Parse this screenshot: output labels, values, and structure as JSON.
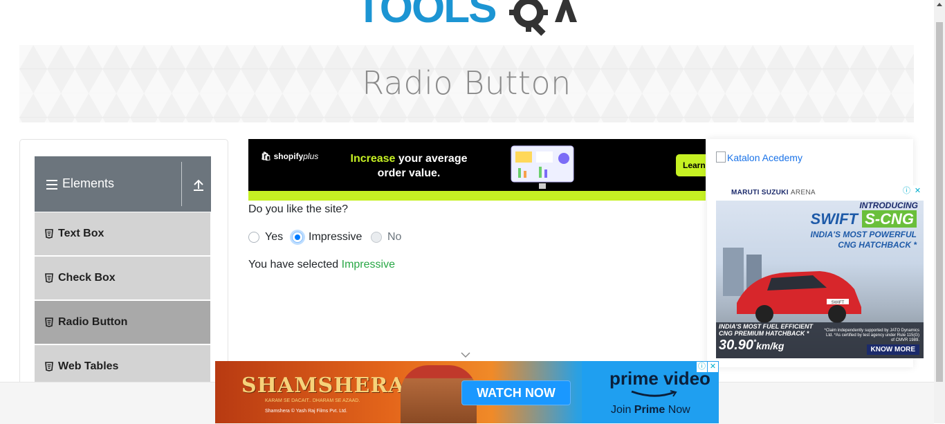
{
  "logo": {
    "text": "TOOLSQA"
  },
  "banner": {
    "title": "Radio Button"
  },
  "sidebar": {
    "group_title": "Elements",
    "items": [
      {
        "label": "Text Box",
        "active": false
      },
      {
        "label": "Check Box",
        "active": false
      },
      {
        "label": "Radio Button",
        "active": true
      },
      {
        "label": "Web Tables",
        "active": false
      }
    ]
  },
  "ad_top": {
    "brand": "shopify",
    "brand_suffix": "plus",
    "headline_highlight": "Increase",
    "headline_rest": " your average order value.",
    "cta": "Learn"
  },
  "main": {
    "question": "Do you like the site?",
    "options": [
      {
        "label": "Yes",
        "checked": false,
        "disabled": false
      },
      {
        "label": "Impressive",
        "checked": true,
        "disabled": false
      },
      {
        "label": "No",
        "checked": false,
        "disabled": true
      }
    ],
    "result_prefix": "You have selected ",
    "result_value": "Impressive"
  },
  "right": {
    "katalon_alt": "Katalon Acedemy",
    "ad": {
      "brand": "MARUTI SUZUKI",
      "brand_sub": "ARENA",
      "introducing": "INTRODUCING",
      "model": "SWIFT",
      "model_tag": "S-CNG",
      "tagline": "INDIA'S MOST POWERFUL CNG HATCHBACK *",
      "efficiency": "INDIA'S MOST FUEL EFFICIENT CNG PREMIUM HATCHBACK *",
      "claim": "*Claim independently supported by JATO Dynamics Ltd. *As certified by test agency under Rule 115(G) of CMVR 1989.",
      "price": "30.90",
      "price_unit": "km/kg",
      "price_mark": "*",
      "cta": "KNOW MORE",
      "car_badge": "SWIFT"
    }
  },
  "ad_bottom": {
    "title": "SHAMSHERA",
    "subtitle": "KARAM SE DACAIT.. DHARAM SE AZAAD.",
    "copyright": "Shamshera © Yash Raj Films Pvt. Ltd.",
    "cta": "WATCH NOW",
    "brand": "prime video",
    "join_prefix": "Join ",
    "join_bold": "Prime",
    "join_suffix": " Now"
  },
  "colors": {
    "sidebar_header": "#6c757d",
    "menu_item": "#d3d3d3",
    "menu_item_active": "#a9a9a9",
    "result_value": "#28a745",
    "radio_checked": "#007bff",
    "logo_blue": "#1c95d3",
    "logo_dark": "#333333"
  },
  "icons": {
    "menu": "hamburger-icon",
    "collapse": "collapse-arrow-icon",
    "item": "document-icon",
    "scroll_hint": "chevron-down-icon"
  }
}
